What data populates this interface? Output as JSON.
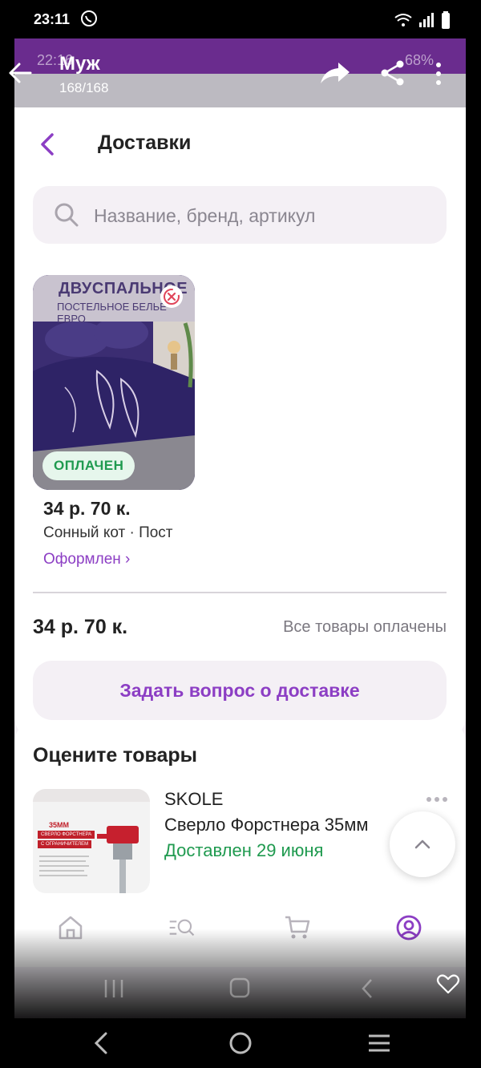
{
  "system": {
    "time": "23:11",
    "viewer_time": "22:16",
    "viewer_battery": "68%"
  },
  "viewer": {
    "contact_name": "Муж",
    "image_counter": "168/168"
  },
  "page": {
    "title": "Доставки"
  },
  "search": {
    "placeholder": "Название, бренд, артикул"
  },
  "order": {
    "image_title_line1": "ДВУСПАЛЬНОЕ",
    "image_title_line2": "ПОСТЕЛЬНОЕ БЕЛЬЕ ЕВРО",
    "badge": "ОПЛАЧЕН",
    "price": "34 р. 70 к.",
    "product_name": "Сонный кот · Пост",
    "status": "Оформлен ›",
    "total": "34 р. 70 к.",
    "total_note": "Все товары оплачены",
    "ask_button": "Задать вопрос о доставке"
  },
  "rate": {
    "title": "Оцените товары",
    "brand": "SKOLE",
    "product": "Сверло Форстнера 35мм",
    "status": "Доставлен 29 июня",
    "thumb_label1": "35ММ",
    "thumb_label2": "СВЕРЛО ФОРСТНЕРА",
    "thumb_label3": "С ОГРАНИЧИТЕЛЕМ"
  },
  "colors": {
    "accent": "#8c3ec4",
    "success": "#1f9a4f",
    "status_purple": "#6a2c8e"
  },
  "icons": {
    "nav": [
      "home-icon",
      "catalog-search-icon",
      "cart-icon",
      "profile-icon"
    ]
  }
}
